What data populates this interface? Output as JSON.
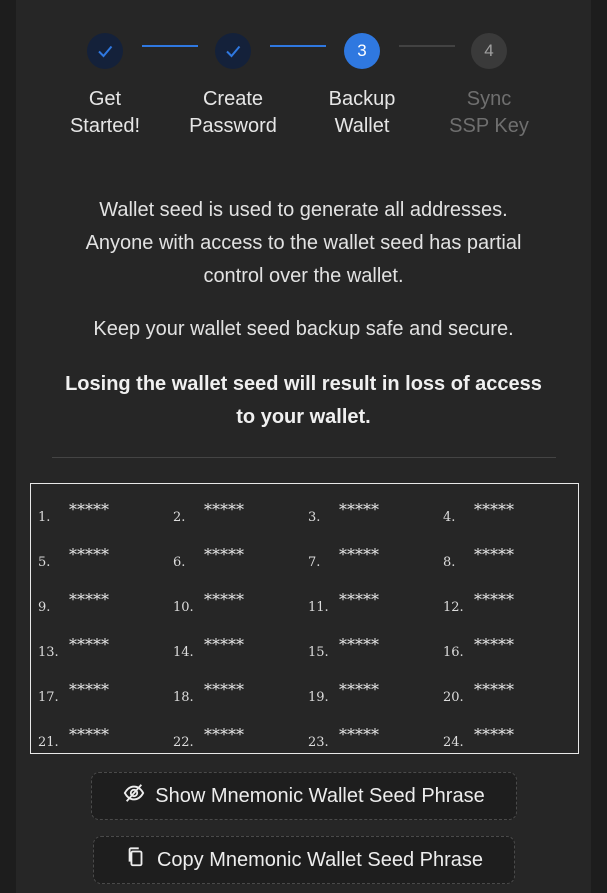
{
  "steps": [
    {
      "label": "Get\nStarted!",
      "state": "done"
    },
    {
      "label": "Create\nPassword",
      "state": "done"
    },
    {
      "label": "Backup\nWallet",
      "number": "3",
      "state": "active"
    },
    {
      "label": "Sync\nSSP Key",
      "number": "4",
      "state": "pending"
    }
  ],
  "info": {
    "line1": "Wallet seed is used to generate all addresses.",
    "line2": "Anyone with access to the wallet seed has partial",
    "line3": "control over the wallet.",
    "keep_safe": "Keep your wallet seed backup safe and secure.",
    "warning1": "Losing the wallet seed will result in loss of access",
    "warning2": "to your wallet."
  },
  "seed": {
    "mask": "*****",
    "numbers": [
      "1.",
      "2.",
      "3.",
      "4.",
      "5.",
      "6.",
      "7.",
      "8.",
      "9.",
      "10.",
      "11.",
      "12.",
      "13.",
      "14.",
      "15.",
      "16.",
      "17.",
      "18.",
      "19.",
      "20.",
      "21.",
      "22.",
      "23.",
      "24."
    ]
  },
  "buttons": {
    "show": "Show Mnemonic Wallet Seed Phrase",
    "copy": "Copy Mnemonic Wallet Seed Phrase"
  },
  "colors": {
    "accent": "#2f78e0",
    "done_circle": "#14213a",
    "panel": "#262626"
  }
}
